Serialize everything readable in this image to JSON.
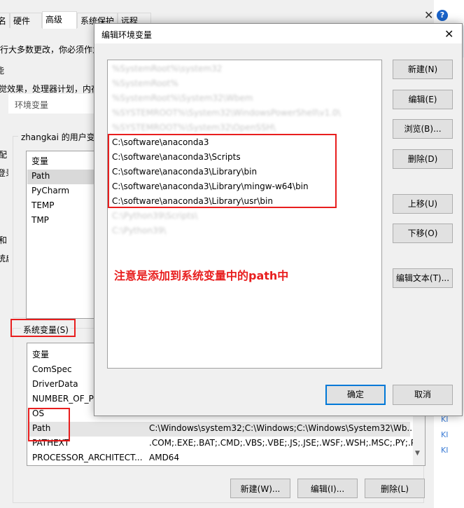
{
  "sysprops": {
    "tabs": [
      "名",
      "硬件",
      "高级",
      "系统保护",
      "远程"
    ],
    "active_tab_index": 2,
    "line1": "行大多数更改，你必须作为",
    "line2": "能",
    "line3": "觉效果，处理器计划，内存",
    "side_frag1": "配",
    "side_frag2": "登录",
    "side_frag3": "和",
    "side_frag4": "统启"
  },
  "envwin": {
    "title": "环境变量",
    "user_group": "zhangkai 的用户变",
    "user_vars": {
      "header": "变量",
      "rows": [
        "Path",
        "PyCharm",
        "TEMP",
        "TMP"
      ]
    },
    "sys_group": "系统变量(S)",
    "sys_vars": {
      "header": "变量",
      "rows": [
        {
          "name": "ComSpec",
          "value": ""
        },
        {
          "name": "DriverData",
          "value": ""
        },
        {
          "name": "NUMBER_OF_P",
          "value": ""
        },
        {
          "name": "OS",
          "value": ""
        },
        {
          "name": "Path",
          "value": "C:\\Windows\\system32;C:\\Windows;C:\\Windows\\System32\\Wb..."
        },
        {
          "name": "PATHEXT",
          "value": ".COM;.EXE;.BAT;.CMD;.VBS;.VBE;.JS;.JSE;.WSF;.WSH;.MSC;.PY;.P..."
        },
        {
          "name": "PROCESSOR_ARCHITECT...",
          "value": "AMD64"
        }
      ]
    },
    "buttons": [
      "新建(W)...",
      "编辑(I)...",
      "删除(L)"
    ]
  },
  "rightstrip": {
    "frag1": "ck",
    "frag2": "KI",
    "frag3": "KI",
    "frag4": "KI"
  },
  "editdlg": {
    "title": "编辑环境变量",
    "close": "✕",
    "blurred_entries": [
      "%SystemRoot%\\system32",
      "%SystemRoot%",
      "%SystemRoot%\\System32\\Wbem",
      "%SYSTEMROOT%\\System32\\WindowsPowerShell\\v1.0\\",
      "%SYSTEMROOT%\\System32\\OpenSSH\\"
    ],
    "entries": [
      "C:\\software\\anaconda3",
      "C:\\software\\anaconda3\\Scripts",
      "C:\\software\\anaconda3\\Library\\bin",
      "C:\\software\\anaconda3\\Library\\mingw-w64\\bin",
      "C:\\software\\anaconda3\\Library\\usr\\bin"
    ],
    "blurred_entries_after": [
      "C:\\Python39\\Scripts\\",
      "C:\\Python39\\"
    ],
    "note": "注意是添加到系统变量中的path中",
    "buttons": {
      "new": "新建(N)",
      "edit": "编辑(E)",
      "browse": "浏览(B)...",
      "delete": "删除(D)",
      "up": "上移(U)",
      "down": "下移(O)",
      "edit_text": "编辑文本(T)...",
      "ok": "确定",
      "cancel": "取消"
    }
  },
  "colors": {
    "annotation_red": "#e81e1e",
    "dialog_bg": "#f0f0f0",
    "primary_border": "#0078d7"
  }
}
